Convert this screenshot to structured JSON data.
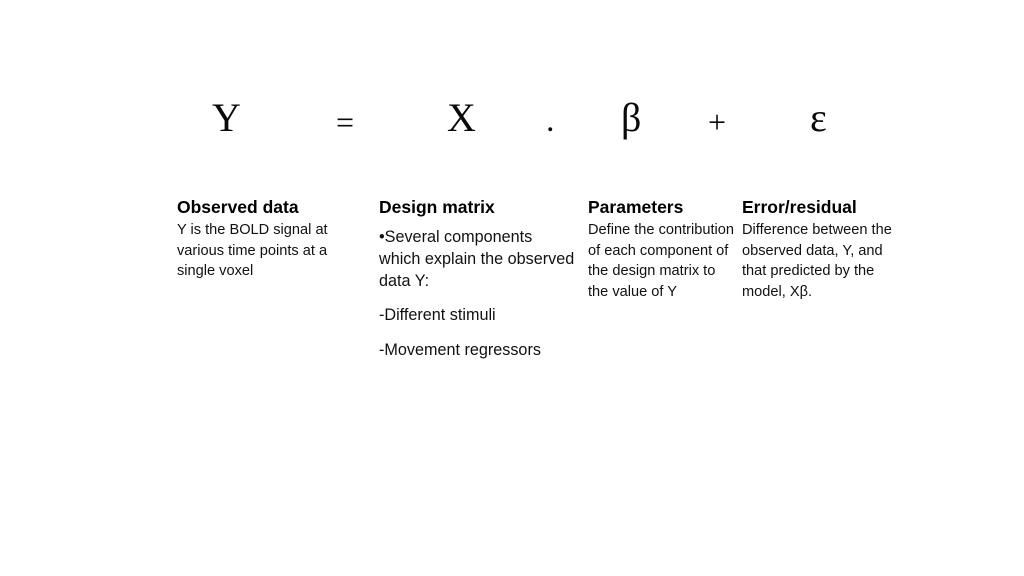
{
  "slide": {
    "background_color": "#ffffff",
    "text_color": "#0a0a0a"
  },
  "equation": {
    "terms": [
      {
        "name": "observed-data-symbol",
        "text": "Y"
      },
      {
        "name": "equals-operator",
        "text": "="
      },
      {
        "name": "design-matrix-symbol",
        "text": "X"
      },
      {
        "name": "multiplication-dot-operator",
        "text": "."
      },
      {
        "name": "parameters-symbol",
        "text": "β"
      },
      {
        "name": "plus-operator",
        "text": "+"
      },
      {
        "name": "error-symbol",
        "text": "ε"
      }
    ],
    "y": "Y",
    "equals": "=",
    "x": "X",
    "dot": ".",
    "beta": "β",
    "plus": "+",
    "epsilon": "ε"
  },
  "columns": [
    {
      "id": "observed-data",
      "heading": "Observed data",
      "paragraphs": [
        "Y is the BOLD signal at various time points at a single voxel"
      ]
    },
    {
      "id": "design-matrix",
      "heading": "Design matrix",
      "paragraphs": [
        "•Several components which explain the observed data Y:",
        "-Different stimuli",
        "-Movement regressors"
      ]
    },
    {
      "id": "parameters",
      "heading": "Parameters",
      "paragraphs": [
        "Define the contribution of each component of the design matrix to the value of Y"
      ]
    },
    {
      "id": "error-residual",
      "heading": "Error/residual",
      "paragraphs": [
        "Difference between the observed data, Y, and that predicted by the model, Xβ."
      ]
    }
  ]
}
